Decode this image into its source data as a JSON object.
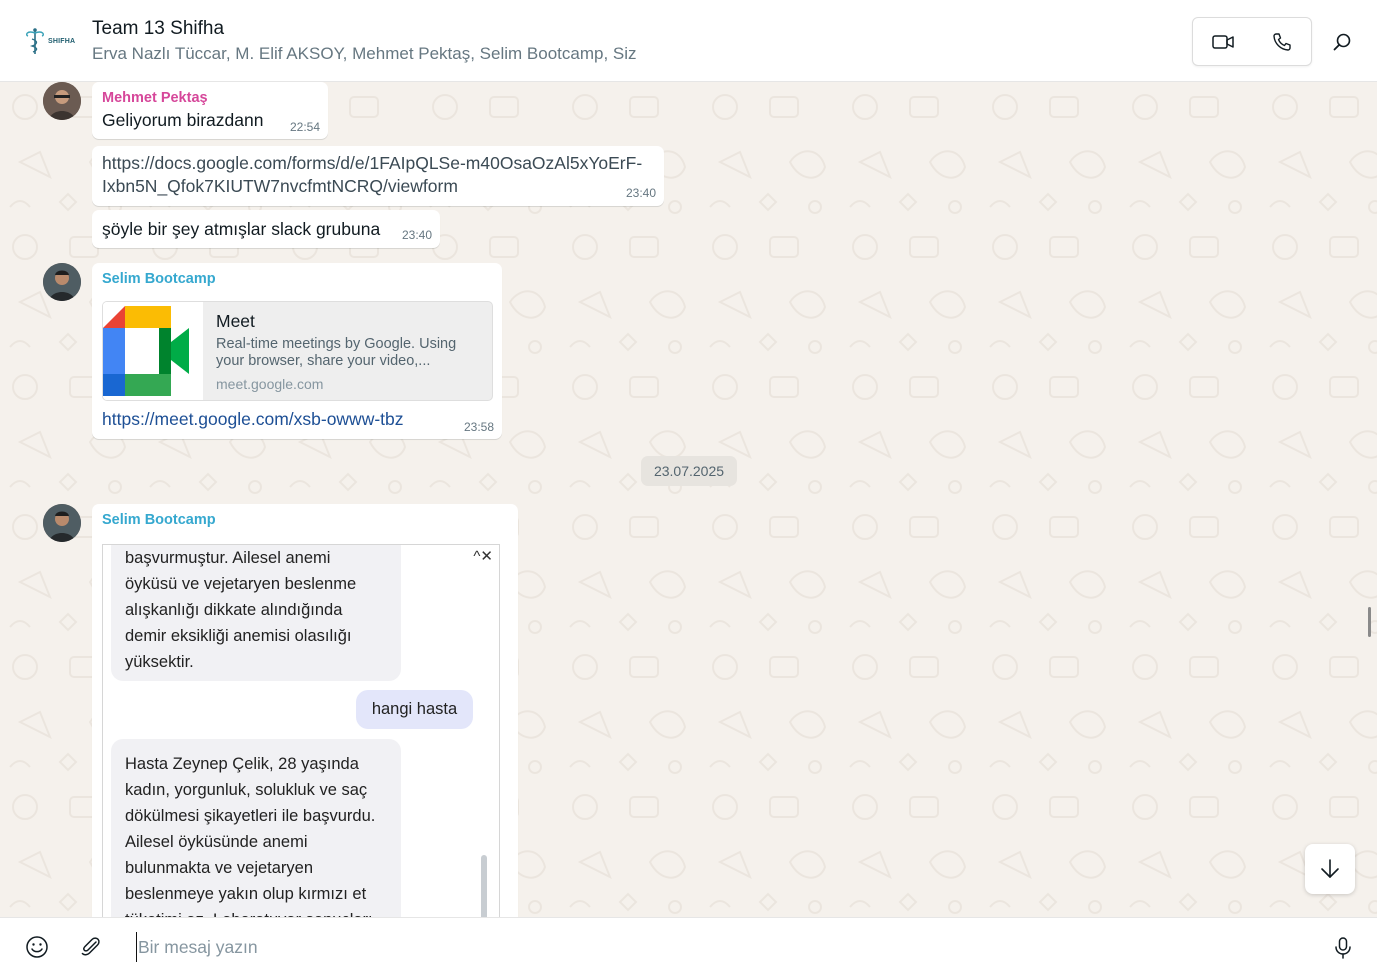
{
  "header": {
    "logo_text": "SHIFHA",
    "title": "Team 13 Shifha",
    "members": "Erva Nazlı Tüccar, M. Elif AKSOY, Mehmet Pektaş, Selim Bootcamp, Siz",
    "icons": {
      "video": "video-call-icon",
      "voice": "phone-icon",
      "search": "search-icon"
    }
  },
  "messages": [
    {
      "sender": "Mehmet Pektaş",
      "sender_color": "#d6479a",
      "text": "Geliyorum birazdann",
      "time": "22:54"
    },
    {
      "text_line1": "https://docs.google.com/forms/d/e/1FAIpQLSe-m40OsaOzAl5xYoErF-",
      "text_line2": "Ixbn5N_Qfok7KIUTW7nvcfmtNCRQ/viewform",
      "time": "23:40"
    },
    {
      "text": "şöyle bir şey atmışlar slack grubuna",
      "time": "23:40"
    },
    {
      "sender": "Selim Bootcamp",
      "sender_color": "#35a8cf",
      "card": {
        "title": "Meet",
        "description": "Real-time meetings by Google. Using your browser, share your video,...",
        "domain": "meet.google.com"
      },
      "link": "https://meet.google.com/xsb-owww-tbz",
      "time": "23:58"
    }
  ],
  "date_divider": "23.07.2025",
  "image_message": {
    "sender": "Selim Bootcamp",
    "sender_color": "#35a8cf",
    "controls": "^✕",
    "ai_reply_1": [
      "başvurmuştur. Ailesel anemi",
      "öyküsü ve vejetaryen beslenme",
      "alışkanlığı dikkate alındığında",
      "demir eksikliği anemisi olasılığı",
      "yüksektir."
    ],
    "user_msg": "hangi hasta",
    "ai_reply_2": [
      "Hasta Zeynep Çelik, 28 yaşında",
      "kadın, yorgunluk, solukluk ve saç",
      "dökülmesi şikayetleri ile başvurdu.",
      "Ailesel öyküsünde anemi",
      "bulunmakta ve vejetaryen",
      "beslenmeye yakın olup kırmızı et",
      "tüketimi az. Laboratuvar sonuçları"
    ]
  },
  "composer": {
    "placeholder": "Bir mesaj yazın",
    "value": "",
    "icons": {
      "emoji": "emoji-icon",
      "attach": "paperclip-icon",
      "mic": "microphone-icon"
    }
  }
}
